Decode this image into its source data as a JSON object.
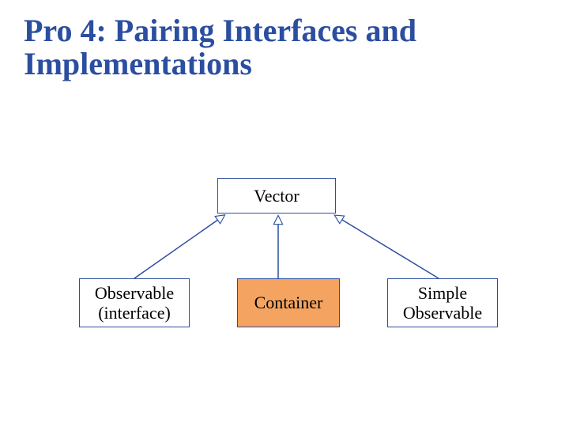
{
  "title": "Pro 4: Pairing Interfaces and Implementations",
  "nodes": {
    "top": "Vector",
    "left_line1": "Observable",
    "left_line2": "(interface)",
    "mid": "Container",
    "right_line1": "Simple",
    "right_line2": "Observable"
  },
  "colors": {
    "accent": "#2b4ea0",
    "highlight_fill": "#f4a460"
  }
}
